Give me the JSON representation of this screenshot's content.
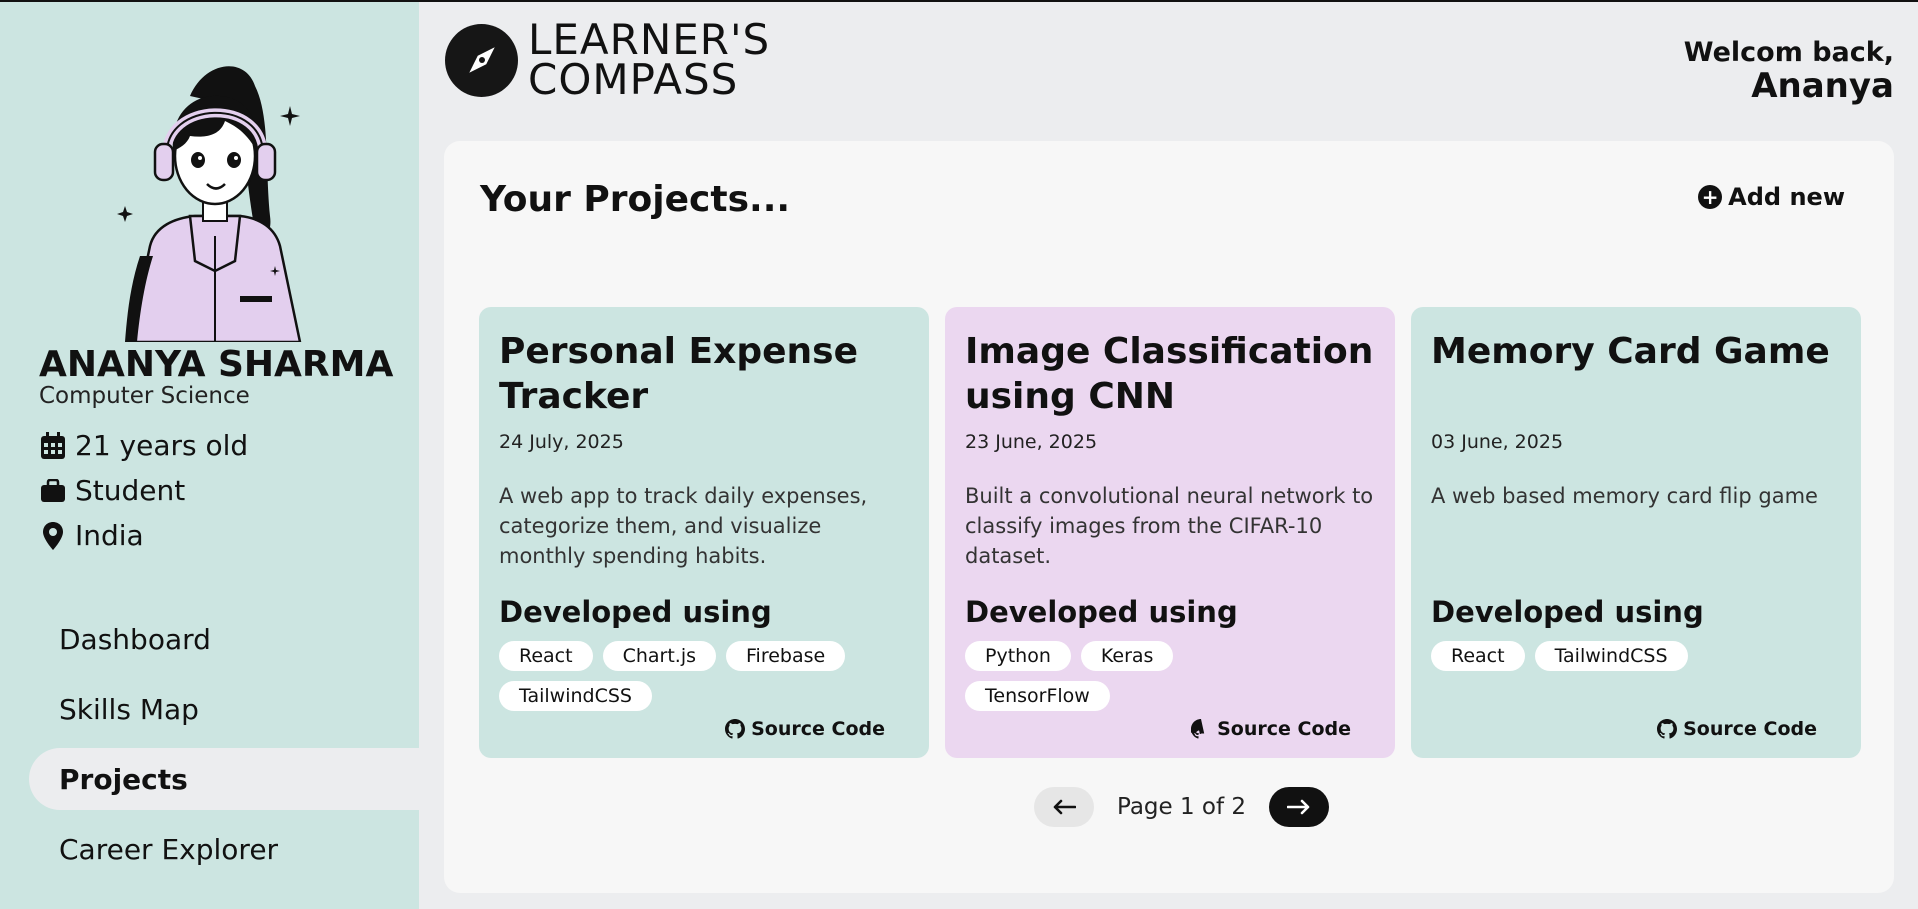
{
  "app": {
    "logo_line1": "LEARNER'S",
    "logo_line2": "COMPASS",
    "logo_icon": "compass-icon"
  },
  "header": {
    "welcome": "Welcom back,",
    "user": "Ananya"
  },
  "profile": {
    "name": "ANANYA SHARMA",
    "department": "Computer Science",
    "age": "21 years old",
    "role": "Student",
    "location": "India"
  },
  "sidebar": {
    "items": [
      {
        "label": "Dashboard",
        "active": false
      },
      {
        "label": "Skills Map",
        "active": false
      },
      {
        "label": "Projects",
        "active": true
      },
      {
        "label": "Career Explorer",
        "active": false
      }
    ]
  },
  "main": {
    "title": "Your Projects...",
    "add_label": "Add new",
    "developed_label": "Developed using",
    "source_label": "Source Code",
    "projects": [
      {
        "title": "Personal Expense Tracker",
        "date": "24 July, 2025",
        "description": "A web app to track daily expenses, categorize them, and visualize monthly spending habits.",
        "tags": [
          "React",
          "Chart.js",
          "Firebase",
          "TailwindCSS"
        ],
        "color": "#cce5e1"
      },
      {
        "title": "Image Classification using CNN",
        "date": "23 June, 2025",
        "description": "Built a convolutional neural network to classify images from the CIFAR-10 dataset.",
        "tags": [
          "Python",
          "Keras",
          "TensorFlow"
        ],
        "color": "#ebd7f0"
      },
      {
        "title": "Memory Card Game",
        "date": "03 June, 2025",
        "description": "A web based memory card flip game",
        "tags": [
          "React",
          "TailwindCSS"
        ],
        "color": "#cce5e1"
      }
    ],
    "pagination": {
      "label": "Page 1 of 2",
      "current": 1,
      "total": 2
    }
  },
  "colors": {
    "sidebar": "#cce5e1",
    "accent_purple": "#ebd7f0",
    "background": "#ecedef",
    "panel": "#f7f7f7"
  }
}
